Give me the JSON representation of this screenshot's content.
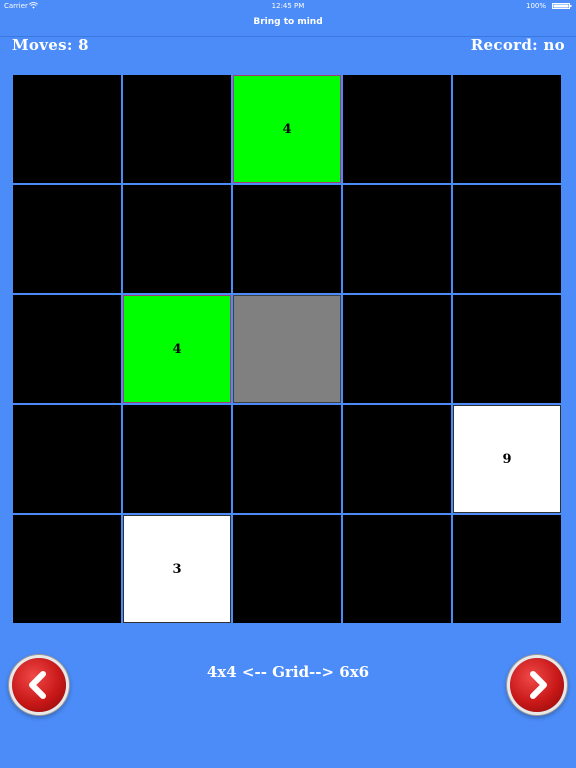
{
  "status_bar": {
    "carrier": "Carrier",
    "time": "12:45 PM",
    "battery": "100%"
  },
  "nav": {
    "title": "Bring to mind"
  },
  "score": {
    "moves": "Moves: 8",
    "record": "Record: no"
  },
  "grid": {
    "size": 5,
    "cells": [
      {
        "state": "hidden",
        "value": ""
      },
      {
        "state": "hidden",
        "value": ""
      },
      {
        "state": "matched",
        "value": "4"
      },
      {
        "state": "hidden",
        "value": ""
      },
      {
        "state": "hidden",
        "value": ""
      },
      {
        "state": "hidden",
        "value": ""
      },
      {
        "state": "hidden",
        "value": ""
      },
      {
        "state": "hidden",
        "value": ""
      },
      {
        "state": "hidden",
        "value": ""
      },
      {
        "state": "hidden",
        "value": ""
      },
      {
        "state": "hidden",
        "value": ""
      },
      {
        "state": "matched",
        "value": "4"
      },
      {
        "state": "disabled",
        "value": ""
      },
      {
        "state": "hidden",
        "value": ""
      },
      {
        "state": "hidden",
        "value": ""
      },
      {
        "state": "hidden",
        "value": ""
      },
      {
        "state": "hidden",
        "value": ""
      },
      {
        "state": "hidden",
        "value": ""
      },
      {
        "state": "hidden",
        "value": ""
      },
      {
        "state": "revealed",
        "value": "9"
      },
      {
        "state": "hidden",
        "value": ""
      },
      {
        "state": "revealed",
        "value": "3"
      },
      {
        "state": "hidden",
        "value": ""
      },
      {
        "state": "hidden",
        "value": ""
      },
      {
        "state": "hidden",
        "value": ""
      }
    ]
  },
  "footer": {
    "grid_size_label": "4x4 <-- Grid--> 6x6",
    "prev_icon": "chevron-left-icon",
    "next_icon": "chevron-right-icon"
  },
  "colors": {
    "background": "#4c8cf8",
    "hidden": "#000000",
    "matched": "#00ff00",
    "disabled": "#808080",
    "revealed": "#ffffff",
    "button": "#c81818"
  }
}
